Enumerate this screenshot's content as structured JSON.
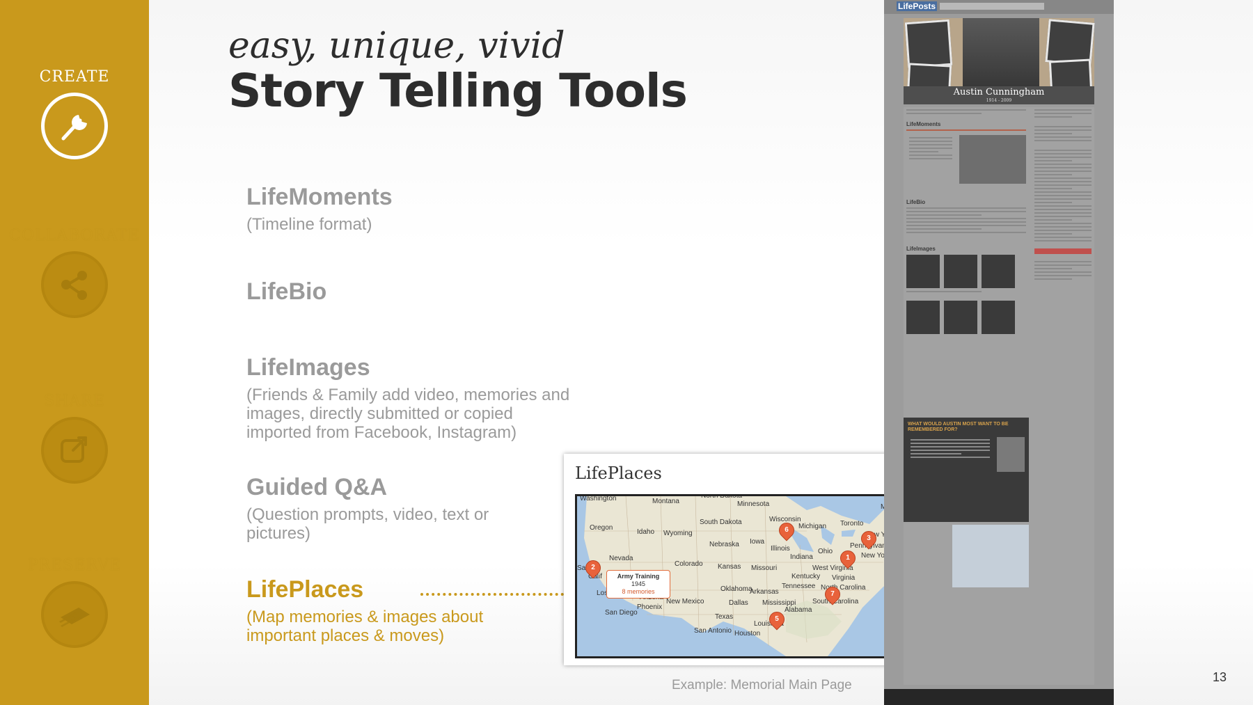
{
  "sidebar": {
    "sections": [
      {
        "label": "CREATE",
        "icon": "wrench-icon",
        "active": true
      },
      {
        "label": "COLLABORATE",
        "icon": "share-nodes-icon",
        "active": false
      },
      {
        "label": "SHARE",
        "icon": "external-link-icon",
        "active": false
      },
      {
        "label": "PRESERVE",
        "icon": "newspaper-stack-icon",
        "active": false
      }
    ]
  },
  "heading": {
    "subtitle": "easy, unique, vivid",
    "title": "Story Telling Tools"
  },
  "features": [
    {
      "title": "LifeMoments",
      "desc": "(Timeline format)"
    },
    {
      "title": "LifeBio",
      "desc": ""
    },
    {
      "title": "LifeImages",
      "desc": "(Friends & Family add video, memories and images, directly submitted or copied imported from Facebook, Instagram)"
    },
    {
      "title": "Guided Q&A",
      "desc": "(Question prompts, video, text or pictures)"
    },
    {
      "title": "LifePlaces",
      "desc": "(Map memories & images about important places & moves)"
    }
  ],
  "places_card": {
    "title": "LifePlaces",
    "popup": {
      "title": "Army Training",
      "year": "1945",
      "memories": "8 memories"
    },
    "map_labels": [
      "Washington",
      "Montana",
      "North Dakota",
      "Minnesota",
      "Oregon",
      "Idaho",
      "South Dakota",
      "Wisconsin",
      "Michigan",
      "Toronto",
      "Montr",
      "Wyoming",
      "Iowa",
      "New Yo",
      "Nebraska",
      "Illinois",
      "Pennsylvania",
      "New York",
      "Nevada",
      "Ohio",
      "Colorado",
      "Kansas",
      "Missouri",
      "Indiana",
      "West Virginia",
      "Kentucky",
      "Virginia",
      "Los Angeles",
      "Arizona",
      "Oklahoma",
      "Arkansas",
      "Tennessee",
      "North Carolina",
      "New Mexico",
      "Dallas",
      "Mississippi",
      "South Carolina",
      "San Diego",
      "Phoenix",
      "Alabama",
      "Texas",
      "Louisiana",
      "San Antonio",
      "Houston",
      "San Fr",
      "Calif"
    ],
    "pins": [
      "1",
      "2",
      "3",
      "5",
      "6",
      "7"
    ]
  },
  "caption": "Example: Memorial Main Page",
  "preview": {
    "logo": "LifePosts",
    "name": "Austin Cunningham",
    "dates": "1914 - 2009",
    "sections": [
      "LifeMoments",
      "LifeBio",
      "LifeImages"
    ],
    "dark_box_title": "WHAT WOULD AUSTIN MOST WANT TO BE REMEMBERED FOR?"
  },
  "page_number": "13",
  "colors": {
    "accent": "#c9991c",
    "text_dark": "#2d2d2d",
    "text_gray": "#9a9a9a",
    "pin": "#e8623b"
  }
}
